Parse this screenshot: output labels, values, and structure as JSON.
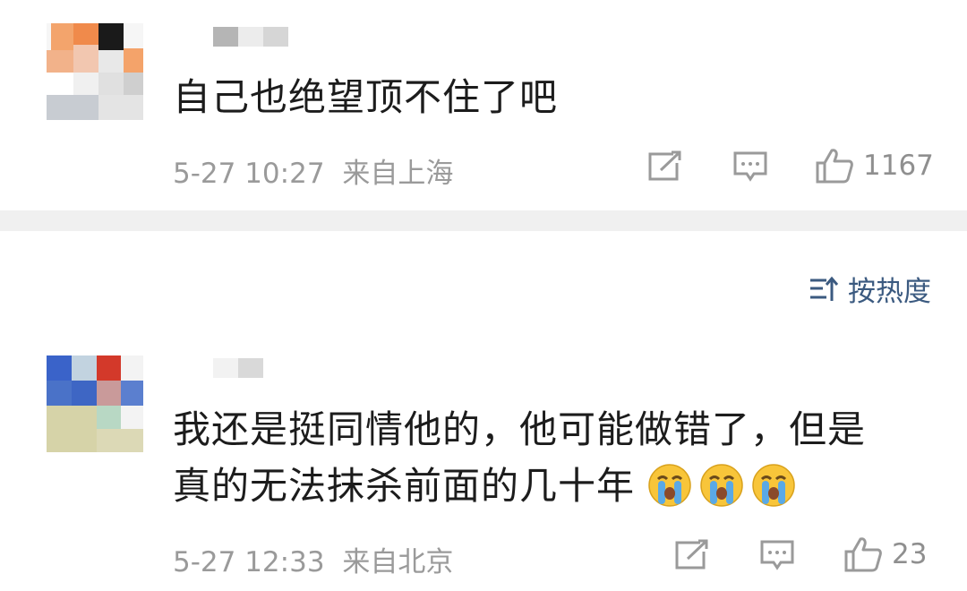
{
  "comments": [
    {
      "text": "自己也绝望顶不住了吧",
      "date": "5-27 10:27",
      "location": "来自上海",
      "likes": "1167",
      "avatar_colors": [
        "#f08a4b",
        "#e9924e",
        "#1a1a1a",
        "#f2c7b0",
        "#f5f5f5",
        "#d9d9d9",
        "#c8ccd2"
      ]
    },
    {
      "text_line1": "我还是挺同情他的，他可能做错了，但是",
      "text_line2": "真的无法抹杀前面的几十年",
      "emojis": [
        "crying-emoji",
        "crying-emoji",
        "crying-emoji"
      ],
      "date": "5-27 12:33",
      "location": "来自北京",
      "likes": "23",
      "avatar_colors": [
        "#3a63c9",
        "#c2d3e0",
        "#d3392a",
        "#4a72c8",
        "#c99a9a",
        "#d6d3a8",
        "#b8d8c4"
      ]
    }
  ],
  "sort": {
    "label": "按热度"
  },
  "colors": {
    "accent": "#3b5a80",
    "meta": "#9a9a9a",
    "divider": "#f0f0f0",
    "emoji": "#f8c53a",
    "tears": "#5aa9e6"
  }
}
